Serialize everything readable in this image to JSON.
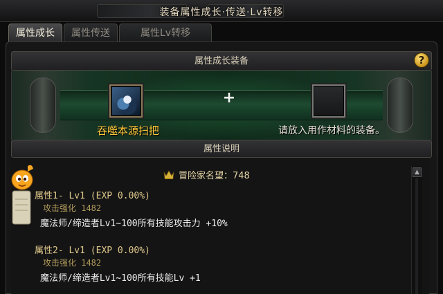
{
  "window": {
    "title": "装备属性成长·传送·Lv转移"
  },
  "tabs": [
    {
      "label": "属性成长",
      "active": true
    },
    {
      "label": "属性传送",
      "active": false
    },
    {
      "label": "属性Lv转移",
      "active": false
    }
  ],
  "growth_panel": {
    "header": "属性成长装备",
    "help_label": "?",
    "plus_label": "+",
    "item_name": "吞噬本源扫把",
    "slot_hint": "请放入用作材料的装备。"
  },
  "attributes_panel": {
    "header": "属性说明",
    "fame_label": "冒险家名望：748",
    "scroll_up": "▲",
    "attributes": [
      {
        "title": "属性1- Lv1 (EXP 0.00%)",
        "stat": "攻击强化 1482",
        "effect": "魔法师/缔造者Lv1~100所有技能攻击力 +10%"
      },
      {
        "title": "属性2- Lv1 (EXP 0.00%)",
        "stat": "攻击强化 1482",
        "effect": "魔法师/缔造者Lv1~100所有技能Lv +1"
      }
    ]
  },
  "colors": {
    "item_name": "#ffc93c",
    "stat": "#b09a5a",
    "title": "#e0c98a"
  },
  "icons": {
    "help": "question-icon",
    "fame": "crown-icon",
    "mascot": "mascot-icon"
  }
}
